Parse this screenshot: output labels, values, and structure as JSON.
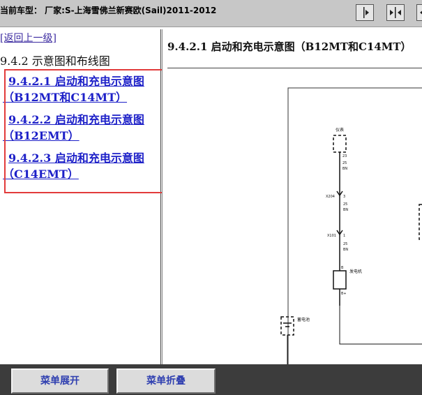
{
  "header": {
    "title": "当前车型： 厂家:S-上海雪佛兰新赛欧(Sail)2011-2012",
    "buttons": [
      {
        "icon": "arrow-right-icon"
      },
      {
        "icon": "arrows-inward-icon"
      },
      {
        "icon": "arrow-left-icon"
      }
    ]
  },
  "left_pane": {
    "back_link": "[返回上一级]",
    "section_title": "9.4.2 示意图和布线图",
    "links": [
      {
        "line1": "9.4.2.1 启动和充电示意图",
        "line2": "（B12MT和C14MT）"
      },
      {
        "line1": "9.4.2.2 启动和充电示意图",
        "line2": "（B12EMT）"
      },
      {
        "line1": "9.4.2.3 启动和充电示意图",
        "line2": "（C14EMT）"
      }
    ]
  },
  "right_pane": {
    "title": "9.4.2.1 启动和充电示意图（B12MT和C14MT）",
    "diagram": {
      "instrument_label": "仪表",
      "pin_instrument": "23",
      "wire_color": "BN",
      "wire_size": "25",
      "connector1": "X204",
      "connector1_pin": "3",
      "connector2": "X101",
      "connector2_pin": "1",
      "generator_label": "发电机",
      "generator_pin_top": "B",
      "generator_pin_bottom": "B+",
      "battery_label": "蓄电池"
    }
  },
  "bottom_bar": {
    "expand_label": "菜单展开",
    "collapse_label": "菜单折叠"
  }
}
